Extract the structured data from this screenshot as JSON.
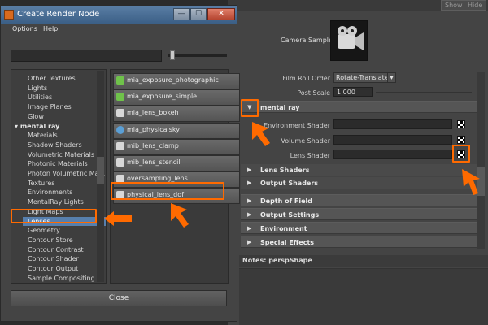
{
  "attribute_editor": {
    "top_buttons": [
      "Show",
      "Hide"
    ],
    "camera_sample_label": "Camera Sample",
    "film_roll_order": {
      "label": "Film Roll Order",
      "value": "Rotate-Translate"
    },
    "post_scale": {
      "label": "Post Scale",
      "value": "1.000"
    },
    "mental_ray_section": "mental ray",
    "shader_fields": [
      {
        "label": "Environment Shader"
      },
      {
        "label": "Volume Shader"
      },
      {
        "label": "Lens Shader"
      }
    ],
    "subsections": [
      "Lens Shaders",
      "Output Shaders"
    ],
    "sections": [
      "Depth of Field",
      "Output Settings",
      "Environment",
      "Special Effects"
    ],
    "notes_label": "Notes:  perspShape"
  },
  "dialog": {
    "title": "Create Render Node",
    "menus": [
      "Options",
      "Help"
    ],
    "window_buttons": {
      "minimize": "—",
      "maximize": "☐",
      "close": "✕"
    },
    "tree_items": [
      {
        "label": "Other Textures",
        "kind": "item"
      },
      {
        "label": "Lights",
        "kind": "item"
      },
      {
        "label": "Utilities",
        "kind": "item"
      },
      {
        "label": "Image Planes",
        "kind": "item"
      },
      {
        "label": "Glow",
        "kind": "item"
      },
      {
        "label": "mental ray",
        "kind": "section"
      },
      {
        "label": "Materials",
        "kind": "item"
      },
      {
        "label": "Shadow Shaders",
        "kind": "item"
      },
      {
        "label": "Volumetric Materials",
        "kind": "item"
      },
      {
        "label": "Photonic Materials",
        "kind": "item"
      },
      {
        "label": "Photon Volumetric Ma...",
        "kind": "item"
      },
      {
        "label": "Textures",
        "kind": "item"
      },
      {
        "label": "Environments",
        "kind": "item"
      },
      {
        "label": "MentalRay Lights",
        "kind": "item"
      },
      {
        "label": "Light Maps",
        "kind": "item"
      },
      {
        "label": "Lenses",
        "kind": "selected"
      },
      {
        "label": "Geometry",
        "kind": "item"
      },
      {
        "label": "Contour Store",
        "kind": "item"
      },
      {
        "label": "Contour Contrast",
        "kind": "item"
      },
      {
        "label": "Contour Shader",
        "kind": "item"
      },
      {
        "label": "Contour Output",
        "kind": "item"
      },
      {
        "label": "Sample Compositing",
        "kind": "item"
      }
    ],
    "node_buttons": [
      {
        "label": "mia_exposure_photographic",
        "icon": "exposure-icon"
      },
      {
        "label": "mia_exposure_simple",
        "icon": "exposure-icon"
      },
      {
        "label": "mia_lens_bokeh",
        "icon": "lens-icon"
      },
      {
        "label": "mia_physicalsky",
        "icon": "sky-icon"
      },
      {
        "label": "mib_lens_clamp",
        "icon": "lens-icon"
      },
      {
        "label": "mib_lens_stencil",
        "icon": "lens-icon"
      },
      {
        "label": "oversampling_lens",
        "icon": "lens-icon"
      },
      {
        "label": "physical_lens_dof",
        "icon": "lens-icon"
      }
    ],
    "close_label": "Close"
  },
  "colors": {
    "annotation": "#ff6a00",
    "selection": "#577fad"
  }
}
